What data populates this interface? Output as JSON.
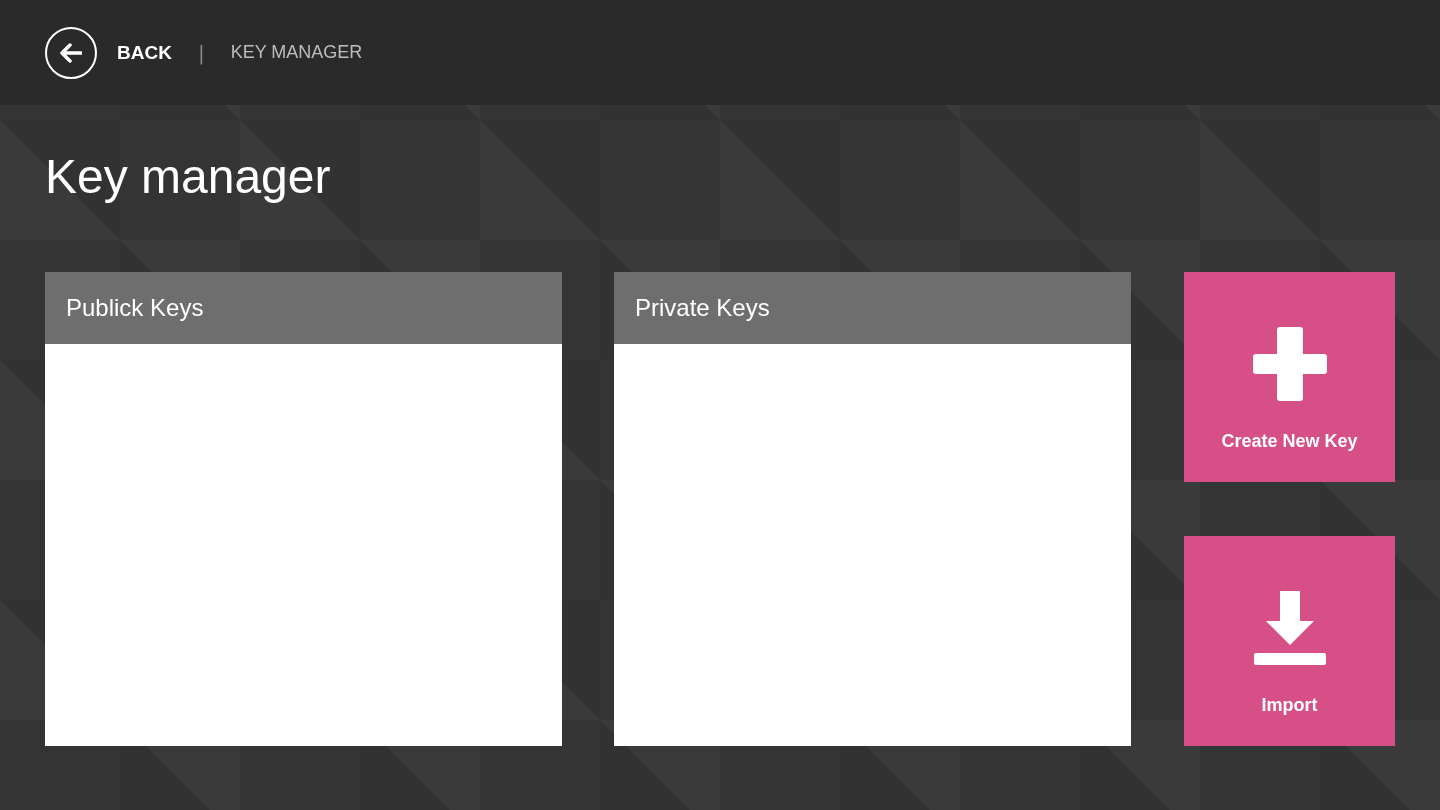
{
  "header": {
    "back_label": "BACK",
    "separator": "|",
    "breadcrumb": "KEY MANAGER"
  },
  "title": "Key manager",
  "panels": [
    {
      "title": "Publick Keys"
    },
    {
      "title": "Private Keys"
    }
  ],
  "actions": [
    {
      "kind": "create",
      "label": "Create New Key"
    },
    {
      "kind": "import",
      "label": "Import"
    }
  ]
}
